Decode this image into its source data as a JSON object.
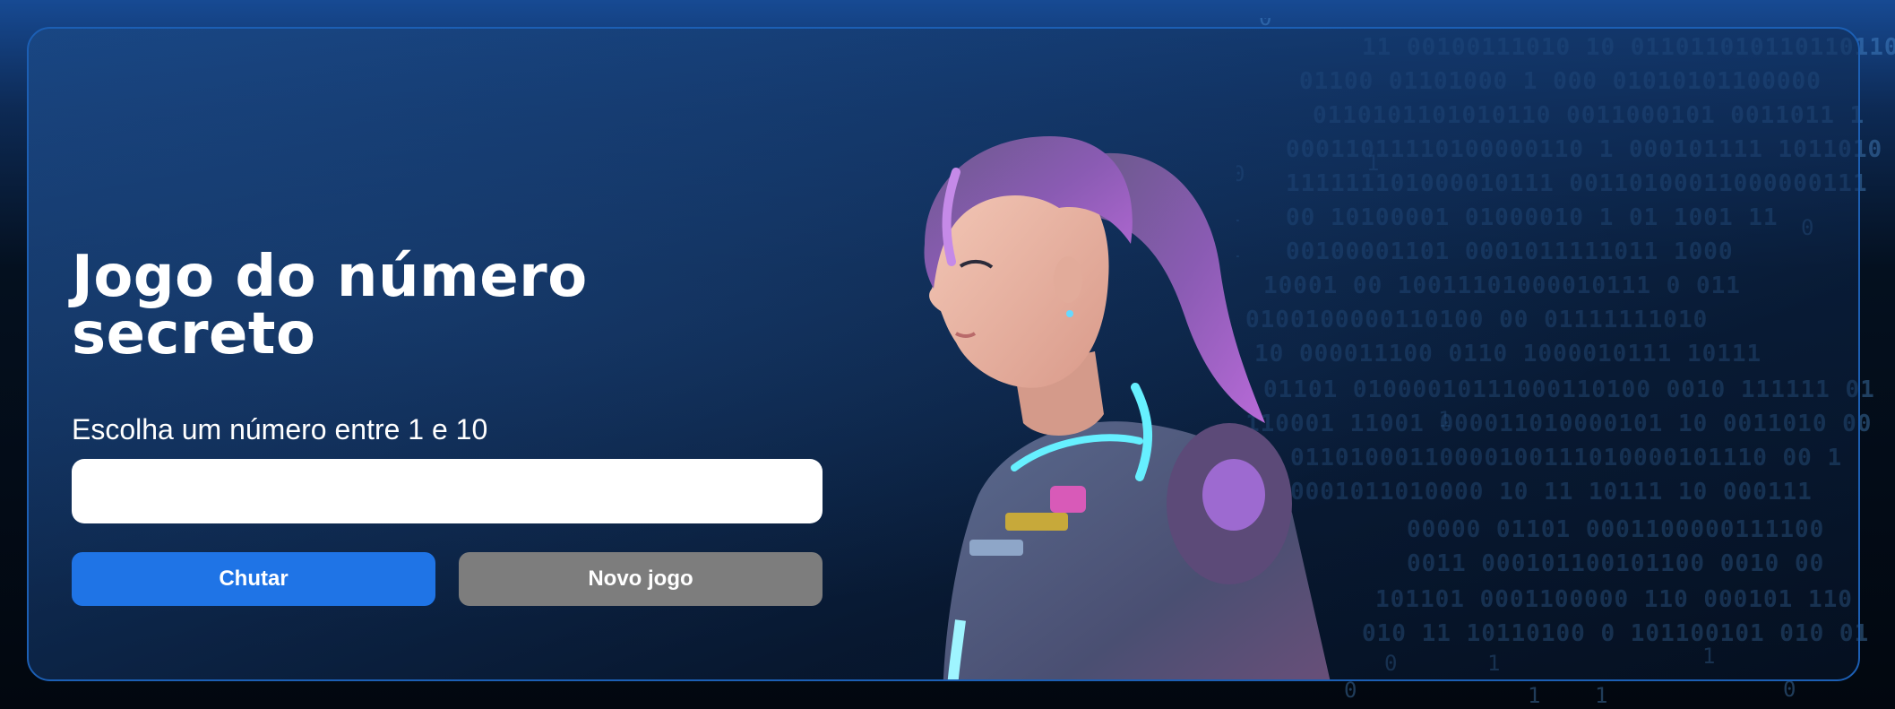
{
  "game": {
    "title": "Jogo do número secreto",
    "prompt": "Escolha um número entre 1 e 10",
    "input_value": "",
    "guess_label": "Chutar",
    "new_game_label": "Novo jogo"
  },
  "background": {
    "binary_rows": [
      "11 00100111010 10 0110110101101101100",
      "01100 01101000 1  000 01010101100000",
      "0110101101010110  0011000101  0011011 1",
      "00011011110100000110 1 000101111  1011010",
      "111111101000010111 00110100011000000111",
      "00 10100001 01000010  1 01 1001 11",
      "00100001101 0001011111011 1000",
      "10001 00 10011101000010111 0 011",
      "0100100000110100 00  01111111010",
      "10 000011100 0110 1000010111 10111",
      "01101 01000010111000110100 0010 111111 01",
      "110001 11001 000011010000101 10 0011010 00",
      "00  01101000110000100111010000101110 00 1",
      "1000001011010000 10 11 10111 10 000111",
      "00000 01101  0001100000111100",
      "0011 000101100101100 0010 00",
      "101101 0001100000 110 000101 110",
      "010 11 10110100 0 101100101 010 01"
    ],
    "stray_digits": [
      "0",
      "1",
      "0",
      "1",
      "0",
      "1",
      "1",
      "0",
      "1",
      "0",
      "1",
      "1",
      "0",
      "1"
    ]
  },
  "colors": {
    "accent": "#1f74e6",
    "secondary_button": "#7d7d7d",
    "card_border": "#1c5fb4",
    "binary_text": "#5aa0e6"
  },
  "icons": {
    "character": "cyberpunk-astronaut-girl-illustration"
  }
}
